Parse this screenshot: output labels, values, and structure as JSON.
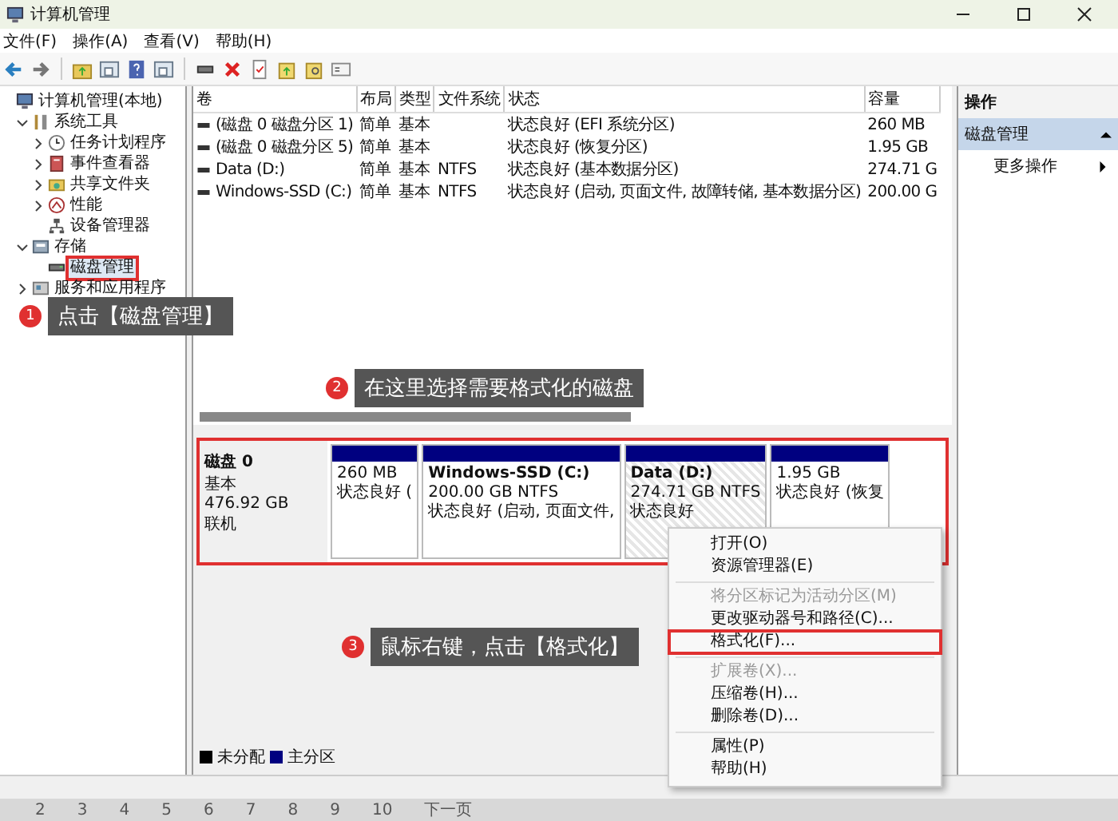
{
  "window": {
    "title": "计算机管理"
  },
  "menu_bar": [
    "文件(F)",
    "操作(A)",
    "查看(V)",
    "帮助(H)"
  ],
  "tree": [
    {
      "label": "计算机管理(本地)",
      "kind": "computer",
      "selected": false,
      "highlighted": false,
      "children": [
        {
          "label": "系统工具",
          "kind": "tools",
          "expanded": true,
          "selected": false,
          "highlighted": false,
          "children": [
            {
              "label": "任务计划程序",
              "kind": "clock",
              "expanded": false,
              "selected": false,
              "highlighted": false
            },
            {
              "label": "事件查看器",
              "kind": "event",
              "expanded": false,
              "selected": false,
              "highlighted": false
            },
            {
              "label": "共享文件夹",
              "kind": "share",
              "expanded": false,
              "selected": false,
              "highlighted": false
            },
            {
              "label": "性能",
              "kind": "perf",
              "expanded": false,
              "selected": false,
              "highlighted": false
            },
            {
              "label": "设备管理器",
              "kind": "device",
              "selected": false,
              "highlighted": false
            }
          ]
        },
        {
          "label": "存储",
          "kind": "storage",
          "expanded": true,
          "selected": false,
          "highlighted": false,
          "children": [
            {
              "label": "磁盘管理",
              "kind": "disk",
              "selected": true,
              "highlighted": true
            }
          ]
        },
        {
          "label": "服务和应用程序",
          "kind": "services",
          "expanded": false,
          "selected": false,
          "highlighted": false
        }
      ]
    }
  ],
  "table": {
    "columns": [
      "卷",
      "布局",
      "类型",
      "文件系统",
      "状态",
      "容量"
    ],
    "rows": [
      [
        "(磁盘 0 磁盘分区 1)",
        "简单",
        "基本",
        "",
        "状态良好 (EFI 系统分区)",
        "260 MB"
      ],
      [
        "(磁盘 0 磁盘分区 5)",
        "简单",
        "基本",
        "",
        "状态良好 (恢复分区)",
        "1.95 GB"
      ],
      [
        "Data (D:)",
        "简单",
        "基本",
        "NTFS",
        "状态良好 (基本数据分区)",
        "274.71 G"
      ],
      [
        "Windows-SSD (C:)",
        "简单",
        "基本",
        "NTFS",
        "状态良好 (启动, 页面文件, 故障转储, 基本数据分区)",
        "200.00 G"
      ]
    ]
  },
  "actions": {
    "title": "操作",
    "section": {
      "label": "磁盘管理",
      "expanded": true
    },
    "items": [
      "更多操作"
    ]
  },
  "disk": {
    "name": "磁盘 0",
    "lines": [
      "基本",
      "476.92 GB",
      "联机"
    ],
    "highlighted": true,
    "partitions": [
      {
        "lines": [
          "260 MB",
          "状态良好 ("
        ],
        "selected": false
      },
      {
        "title": "Windows-SSD  (C:)",
        "lines": [
          "200.00 GB NTFS",
          "状态良好 (启动, 页面文件,"
        ],
        "selected": false
      },
      {
        "title": "Data  (D:)",
        "lines": [
          "274.71 GB NTFS",
          "状态良好"
        ],
        "selected": true
      },
      {
        "lines": [
          "1.95 GB",
          "状态良好 (恢复"
        ],
        "selected": false
      }
    ]
  },
  "legend": [
    {
      "label": "未分配",
      "color": "#000000"
    },
    {
      "label": "主分区",
      "color": "#000080"
    }
  ],
  "context_menu": [
    {
      "kind": "item",
      "label": "打开(O)",
      "disabled": false,
      "highlighted": false
    },
    {
      "kind": "item",
      "label": "资源管理器(E)",
      "disabled": false,
      "highlighted": false
    },
    {
      "kind": "separator"
    },
    {
      "kind": "item",
      "label": "将分区标记为活动分区(M)",
      "disabled": true,
      "highlighted": false
    },
    {
      "kind": "item",
      "label": "更改驱动器号和路径(C)...",
      "disabled": false,
      "highlighted": false
    },
    {
      "kind": "item",
      "label": "格式化(F)...",
      "disabled": false,
      "highlighted": true
    },
    {
      "kind": "separator"
    },
    {
      "kind": "item",
      "label": "扩展卷(X)...",
      "disabled": true,
      "highlighted": false
    },
    {
      "kind": "item",
      "label": "压缩卷(H)...",
      "disabled": false,
      "highlighted": false
    },
    {
      "kind": "item",
      "label": "删除卷(D)...",
      "disabled": false,
      "highlighted": false
    },
    {
      "kind": "separator"
    },
    {
      "kind": "item",
      "label": "属性(P)",
      "disabled": false,
      "highlighted": false
    },
    {
      "kind": "item",
      "label": "帮助(H)",
      "disabled": false,
      "highlighted": false
    }
  ],
  "callouts": [
    {
      "number": "1",
      "text": "点击【磁盘管理】"
    },
    {
      "number": "2",
      "text": "在这里选择需要格式化的磁盘"
    },
    {
      "number": "3",
      "text": "鼠标右键，点击【格式化】"
    }
  ],
  "pager": [
    "2",
    "3",
    "4",
    "5",
    "6",
    "7",
    "8",
    "9",
    "10",
    "下一页"
  ]
}
